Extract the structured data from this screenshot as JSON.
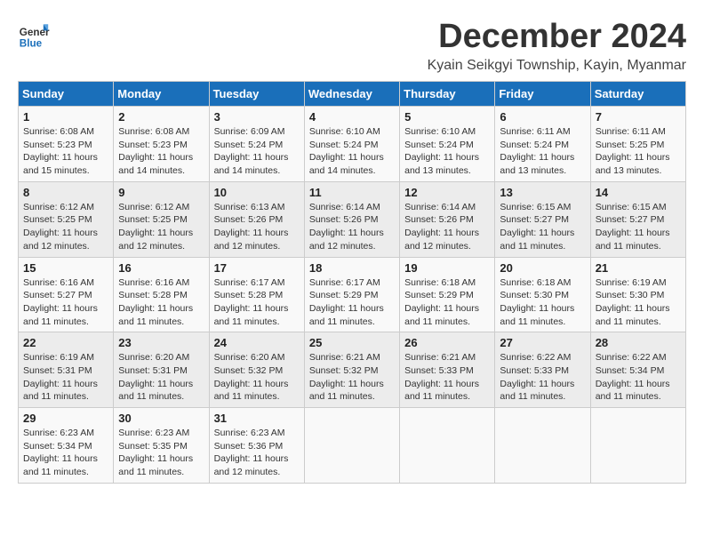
{
  "header": {
    "logo_line1": "General",
    "logo_line2": "Blue",
    "month": "December 2024",
    "location": "Kyain Seikgyi Township, Kayin, Myanmar"
  },
  "columns": [
    "Sunday",
    "Monday",
    "Tuesday",
    "Wednesday",
    "Thursday",
    "Friday",
    "Saturday"
  ],
  "weeks": [
    [
      {
        "day": "1",
        "info": "Sunrise: 6:08 AM\nSunset: 5:23 PM\nDaylight: 11 hours\nand 15 minutes."
      },
      {
        "day": "2",
        "info": "Sunrise: 6:08 AM\nSunset: 5:23 PM\nDaylight: 11 hours\nand 14 minutes."
      },
      {
        "day": "3",
        "info": "Sunrise: 6:09 AM\nSunset: 5:24 PM\nDaylight: 11 hours\nand 14 minutes."
      },
      {
        "day": "4",
        "info": "Sunrise: 6:10 AM\nSunset: 5:24 PM\nDaylight: 11 hours\nand 14 minutes."
      },
      {
        "day": "5",
        "info": "Sunrise: 6:10 AM\nSunset: 5:24 PM\nDaylight: 11 hours\nand 13 minutes."
      },
      {
        "day": "6",
        "info": "Sunrise: 6:11 AM\nSunset: 5:24 PM\nDaylight: 11 hours\nand 13 minutes."
      },
      {
        "day": "7",
        "info": "Sunrise: 6:11 AM\nSunset: 5:25 PM\nDaylight: 11 hours\nand 13 minutes."
      }
    ],
    [
      {
        "day": "8",
        "info": "Sunrise: 6:12 AM\nSunset: 5:25 PM\nDaylight: 11 hours\nand 12 minutes."
      },
      {
        "day": "9",
        "info": "Sunrise: 6:12 AM\nSunset: 5:25 PM\nDaylight: 11 hours\nand 12 minutes."
      },
      {
        "day": "10",
        "info": "Sunrise: 6:13 AM\nSunset: 5:26 PM\nDaylight: 11 hours\nand 12 minutes."
      },
      {
        "day": "11",
        "info": "Sunrise: 6:14 AM\nSunset: 5:26 PM\nDaylight: 11 hours\nand 12 minutes."
      },
      {
        "day": "12",
        "info": "Sunrise: 6:14 AM\nSunset: 5:26 PM\nDaylight: 11 hours\nand 12 minutes."
      },
      {
        "day": "13",
        "info": "Sunrise: 6:15 AM\nSunset: 5:27 PM\nDaylight: 11 hours\nand 11 minutes."
      },
      {
        "day": "14",
        "info": "Sunrise: 6:15 AM\nSunset: 5:27 PM\nDaylight: 11 hours\nand 11 minutes."
      }
    ],
    [
      {
        "day": "15",
        "info": "Sunrise: 6:16 AM\nSunset: 5:27 PM\nDaylight: 11 hours\nand 11 minutes."
      },
      {
        "day": "16",
        "info": "Sunrise: 6:16 AM\nSunset: 5:28 PM\nDaylight: 11 hours\nand 11 minutes."
      },
      {
        "day": "17",
        "info": "Sunrise: 6:17 AM\nSunset: 5:28 PM\nDaylight: 11 hours\nand 11 minutes."
      },
      {
        "day": "18",
        "info": "Sunrise: 6:17 AM\nSunset: 5:29 PM\nDaylight: 11 hours\nand 11 minutes."
      },
      {
        "day": "19",
        "info": "Sunrise: 6:18 AM\nSunset: 5:29 PM\nDaylight: 11 hours\nand 11 minutes."
      },
      {
        "day": "20",
        "info": "Sunrise: 6:18 AM\nSunset: 5:30 PM\nDaylight: 11 hours\nand 11 minutes."
      },
      {
        "day": "21",
        "info": "Sunrise: 6:19 AM\nSunset: 5:30 PM\nDaylight: 11 hours\nand 11 minutes."
      }
    ],
    [
      {
        "day": "22",
        "info": "Sunrise: 6:19 AM\nSunset: 5:31 PM\nDaylight: 11 hours\nand 11 minutes."
      },
      {
        "day": "23",
        "info": "Sunrise: 6:20 AM\nSunset: 5:31 PM\nDaylight: 11 hours\nand 11 minutes."
      },
      {
        "day": "24",
        "info": "Sunrise: 6:20 AM\nSunset: 5:32 PM\nDaylight: 11 hours\nand 11 minutes."
      },
      {
        "day": "25",
        "info": "Sunrise: 6:21 AM\nSunset: 5:32 PM\nDaylight: 11 hours\nand 11 minutes."
      },
      {
        "day": "26",
        "info": "Sunrise: 6:21 AM\nSunset: 5:33 PM\nDaylight: 11 hours\nand 11 minutes."
      },
      {
        "day": "27",
        "info": "Sunrise: 6:22 AM\nSunset: 5:33 PM\nDaylight: 11 hours\nand 11 minutes."
      },
      {
        "day": "28",
        "info": "Sunrise: 6:22 AM\nSunset: 5:34 PM\nDaylight: 11 hours\nand 11 minutes."
      }
    ],
    [
      {
        "day": "29",
        "info": "Sunrise: 6:23 AM\nSunset: 5:34 PM\nDaylight: 11 hours\nand 11 minutes."
      },
      {
        "day": "30",
        "info": "Sunrise: 6:23 AM\nSunset: 5:35 PM\nDaylight: 11 hours\nand 11 minutes."
      },
      {
        "day": "31",
        "info": "Sunrise: 6:23 AM\nSunset: 5:36 PM\nDaylight: 11 hours\nand 12 minutes."
      },
      {
        "day": "",
        "info": ""
      },
      {
        "day": "",
        "info": ""
      },
      {
        "day": "",
        "info": ""
      },
      {
        "day": "",
        "info": ""
      }
    ]
  ]
}
